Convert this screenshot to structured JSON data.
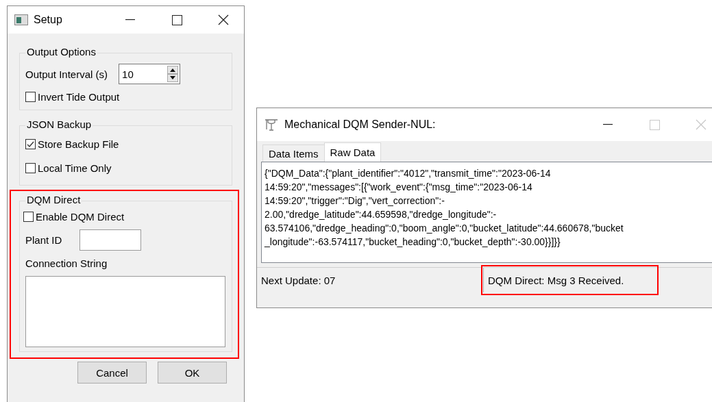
{
  "setup_window": {
    "title": "Setup",
    "maximize_enabled": true,
    "close_enabled": true,
    "output_options": {
      "title": "Output Options",
      "interval_label": "Output Interval (s)",
      "interval_value": "10",
      "invert_tide": {
        "label": "Invert Tide Output",
        "checked": false
      }
    },
    "json_backup": {
      "title": "JSON Backup",
      "options": [
        {
          "label": "Store Backup File",
          "checked": true
        },
        {
          "label": "Local Time Only",
          "checked": false
        }
      ]
    },
    "dqm_direct": {
      "title": "DQM Direct",
      "highlighted": true,
      "enable": {
        "label": "Enable DQM Direct",
        "checked": false
      },
      "plant_id_label": "Plant ID",
      "connection_label": "Connection String"
    },
    "buttons": [
      "Cancel",
      "OK"
    ]
  },
  "sender_window": {
    "title": "Mechanical DQM Sender-NUL:",
    "maximize_enabled": false,
    "close_enabled": false,
    "tabs": [
      {
        "label": "Data Items",
        "selected": false
      },
      {
        "label": "Raw Data",
        "selected": true
      }
    ],
    "raw_data_lines": [
      "{\"DQM_Data\":{\"plant_identifier\":\"4012\",\"transmit_time\":\"2023-06-14",
      "14:59:20\",\"messages\":[{\"work_event\":{\"msg_time\":\"2023-06-14",
      "14:59:20\",\"trigger\":\"Dig\",\"vert_correction\":-",
      "2.00,\"dredge_latitude\":44.659598,\"dredge_longitude\":-",
      "63.574106,\"dredge_heading\":0,\"boom_angle\":0,\"bucket_latitude\":44.660678,\"bucket",
      "_longitude\":-63.574117,\"bucket_heading\":0,\"bucket_depth\":-30.00}}]}}"
    ],
    "status_bar": {
      "next_update": "Next Update: 07",
      "dqm_status": "DQM Direct: Msg 3 Received.",
      "dqm_status_highlighted": true
    }
  }
}
